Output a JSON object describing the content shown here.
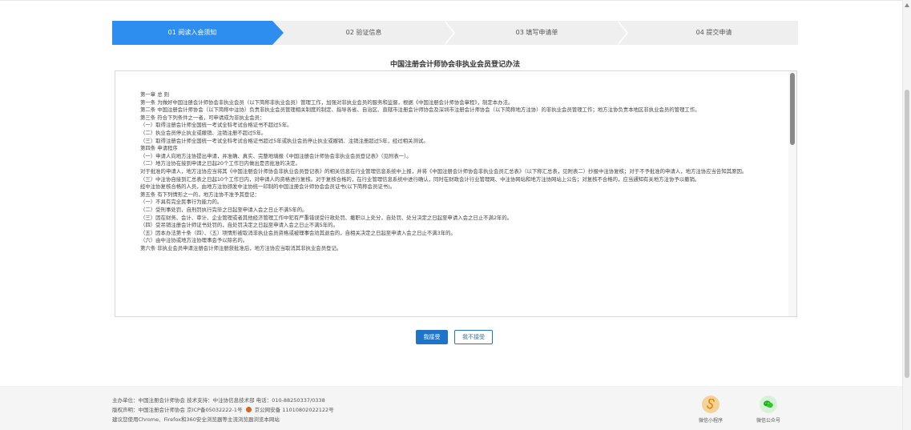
{
  "steps": [
    {
      "label": "01 阅读入会须知",
      "active": true
    },
    {
      "label": "02 验证信息",
      "active": false
    },
    {
      "label": "03 填写申请单",
      "active": false
    },
    {
      "label": "04 提交申请",
      "active": false
    }
  ],
  "doc": {
    "title": "中国注册会计师协会非执业会员登记办法",
    "lines": [
      "第一章 总 则",
      "第一条 为做好中国注册会计师协会非执业会员（以下简称非执业会员）管理工作，加强对非执业会员的服务和监督，根据《中国注册会计师协会章程》，制定本办法。",
      "第二条 中国注册会计师协会（以下简称中注协）负责非执业会员管理相关制度的制定、指导各省、自治区、直辖市注册会计师协会及深圳市注册会计师协会（以下简称地方注协）的非执业会员管理工作；地方注协负责本地区非执业会员的管理工作。",
      "第三条 符合下列条件之一者，可申请成为非执业会员：",
      "（一）取得注册会计师全国统一考试全科考试合格证书不超过5年。",
      "（二）执业会员停止执业或撤销、注销注册不超过5年。",
      "（三）取得注册会计师全国统一考试全科考试合格证书超过5年或执业会员停止执业或撤销、注销注册超过5年，经过相关测试。",
      "第四条 申请程序",
      "（一）申请人向地方注协提出申请，并准确、真实、完整地填报《中国注册会计师协会非执业会员登记表》（见附表一）。",
      "（二）地方注协在接到申请之日起20个工作日内做出是否批准的决定。",
      "  对于批准的申请人，地方注协应当将其《中国注册会计师协会非执业会员登记表》的相关信息在行业管理信息系统中上报，并将《中国注册会计师协会非执业会员汇总表》（以下称汇总表，见附表二）抄报中注协复核；对于不予批准的申请人，地方注协应当告知其原因。",
      "（三）中注协自接到汇总表之日起10个工作日内，对申请人的资格进行复核。对于复核合格的，在行业管理信息系统中进行确认，同时在财政会计行业管理网、中注协网站和地方注协网站上公告；对复核不合格的，应当通知有关地方注协予以撤销。",
      "  经中注协复核合格的人员，由地方注协颁发中注协统一印制的中国注册会计师协会会员证书(以下简称会员证书)。",
      "第五条 有下列情形之一的，地方注协不准予其登记：",
      "（一）不具有完全民事行为能力的。",
      "（二）受刑事处罚，自刑罚执行完毕之日起至申请入会之日止不满5年的。",
      "（三）因在财务、会计、审计、企业管理或者其他经济管理工作中犯有严重错误受行政处罚、撤职以上处分，自处罚、处分决定之日起至申请入会之日止不满2年的。",
      "（四）受吊销注册会计师证书处罚的，自处罚决定之日起至申请入会之日止不满5年的。",
      "（五）因本办法第十条（四）、（五）项情形被取消非执业会员资格或被理事会劝其退会的，自相关决定之日起至申请入会之日止不满3年的。",
      "（六）由中注协或地方注协理事会予以除名的。",
      "第六条 非执业会员申请注册会计师注册获批准后，地方注协应当取消其非执业会员登记。"
    ]
  },
  "buttons": {
    "accept": "我接受",
    "reject": "我不接受"
  },
  "footer": {
    "line1": "主办单位：中国注册会计师协会 技术支持：中注协信息技术部 电话：010-88250337/0338",
    "line2_a": "版权声明：中国注册会计师协会 京ICP备05032222-1号",
    "line2_b": "京公网安备 11010802022122号",
    "line3": "建议您使用Chrome、Firefox和360安全浏览器等主流浏览器浏览本网站",
    "mini_program": "微信小程序",
    "wechat_official": "微信公众号"
  }
}
